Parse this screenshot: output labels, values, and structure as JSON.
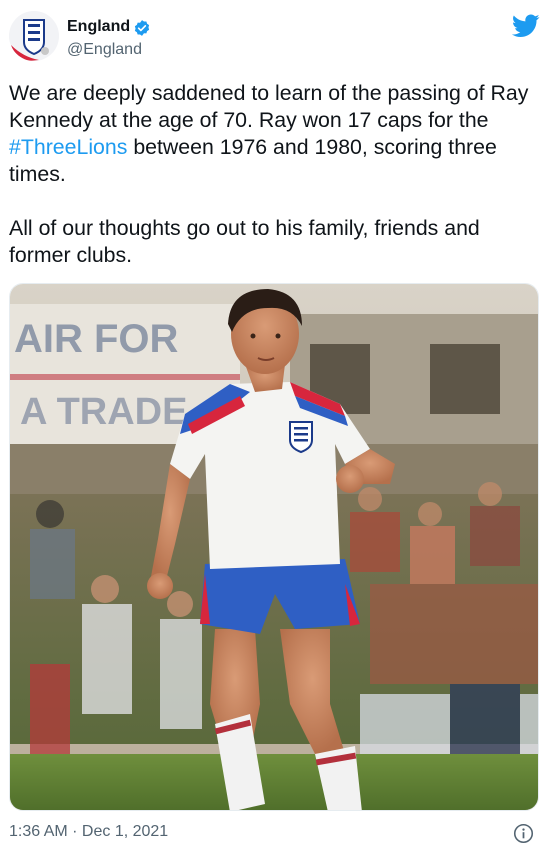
{
  "account": {
    "display_name": "England",
    "handle": "@England",
    "verified_icon": "verified-badge-icon",
    "avatar_icon": "three-lions-crest-icon",
    "platform_icon": "twitter-bird-icon"
  },
  "tweet": {
    "text_before_hashtag": "We are deeply saddened to learn of the passing of Ray Kennedy at the age of 70. Ray won 17 caps for the ",
    "hashtag": "#ThreeLions",
    "text_after_hashtag": " between 1976 and 1980, scoring three times.",
    "paragraph2": "All of our thoughts go out to his family, friends and former clubs.",
    "photo_banner_text": "AIR FOR",
    "photo_banner_text_2": "A TRADE"
  },
  "footer": {
    "timestamp": "1:36 AM · Dec 1, 2021",
    "info_icon": "info-icon"
  },
  "colors": {
    "accent": "#1d9bf0",
    "text": "#0f1419",
    "secondary": "#536471"
  }
}
